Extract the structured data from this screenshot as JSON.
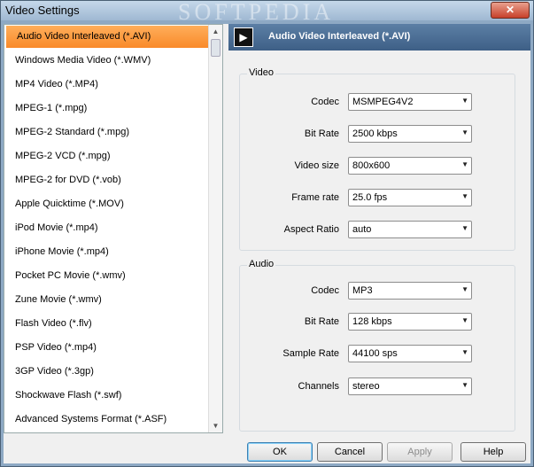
{
  "window": {
    "title": "Video Settings",
    "close": "✕",
    "watermark": "SOFTPEDIA"
  },
  "formats": [
    "Audio Video Interleaved (*.AVI)",
    "Windows Media Video (*.WMV)",
    "MP4 Video (*.MP4)",
    "MPEG-1 (*.mpg)",
    "MPEG-2 Standard (*.mpg)",
    "MPEG-2 VCD (*.mpg)",
    "MPEG-2 for DVD (*.vob)",
    "Apple Quicktime (*.MOV)",
    "iPod Movie (*.mp4)",
    "iPhone Movie (*.mp4)",
    "Pocket PC Movie (*.wmv)",
    "Zune Movie (*.wmv)",
    "Flash Video (*.flv)",
    "PSP Video (*.mp4)",
    "3GP Video (*.3gp)",
    "Shockwave Flash (*.swf)",
    "Advanced Systems Format (*.ASF)"
  ],
  "header": {
    "title": "Audio Video Interleaved (*.AVI)"
  },
  "video": {
    "label": "Video",
    "rows": [
      {
        "label": "Codec",
        "value": "MSMPEG4V2"
      },
      {
        "label": "Bit Rate",
        "value": "2500 kbps"
      },
      {
        "label": "Video size",
        "value": "800x600"
      },
      {
        "label": "Frame rate",
        "value": "25.0 fps"
      },
      {
        "label": "Aspect Ratio",
        "value": "auto"
      }
    ]
  },
  "audio": {
    "label": "Audio",
    "rows": [
      {
        "label": "Codec",
        "value": "MP3"
      },
      {
        "label": "Bit Rate",
        "value": "128 kbps"
      },
      {
        "label": "Sample Rate",
        "value": "44100 sps"
      },
      {
        "label": "Channels",
        "value": "stereo"
      }
    ]
  },
  "buttons": {
    "ok": "OK",
    "cancel": "Cancel",
    "apply": "Apply",
    "help": "Help"
  }
}
